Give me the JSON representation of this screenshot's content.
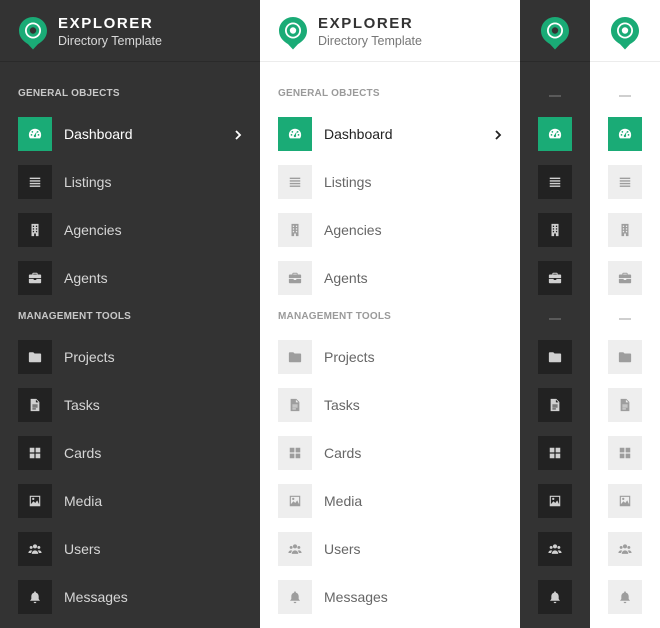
{
  "brand": {
    "title": "EXPLORER",
    "subtitle": "Directory Template",
    "accent_color": "#1aab76",
    "logo_icon": "map-pin-icon"
  },
  "sections": [
    {
      "label": "GENERAL OBJECTS"
    },
    {
      "label": "MANAGEMENT TOOLS"
    }
  ],
  "items": [
    {
      "label": "Dashboard",
      "icon": "speedometer-icon",
      "active": true
    },
    {
      "label": "Listings",
      "icon": "list-icon"
    },
    {
      "label": "Agencies",
      "icon": "building-icon"
    },
    {
      "label": "Agents",
      "icon": "briefcase-icon"
    },
    {
      "label": "Projects",
      "icon": "folder-icon"
    },
    {
      "label": "Tasks",
      "icon": "document-icon"
    },
    {
      "label": "Cards",
      "icon": "grid-icon"
    },
    {
      "label": "Media",
      "icon": "image-icon"
    },
    {
      "label": "Users",
      "icon": "users-icon"
    },
    {
      "label": "Messages",
      "icon": "bell-icon"
    }
  ],
  "variants": [
    {
      "theme": "dark",
      "mode": "full",
      "bg": "#333333"
    },
    {
      "theme": "light",
      "mode": "full",
      "bg": "#ffffff"
    },
    {
      "theme": "dark",
      "mode": "collapsed",
      "bg": "#333333"
    },
    {
      "theme": "light",
      "mode": "collapsed",
      "bg": "#ffffff"
    }
  ]
}
